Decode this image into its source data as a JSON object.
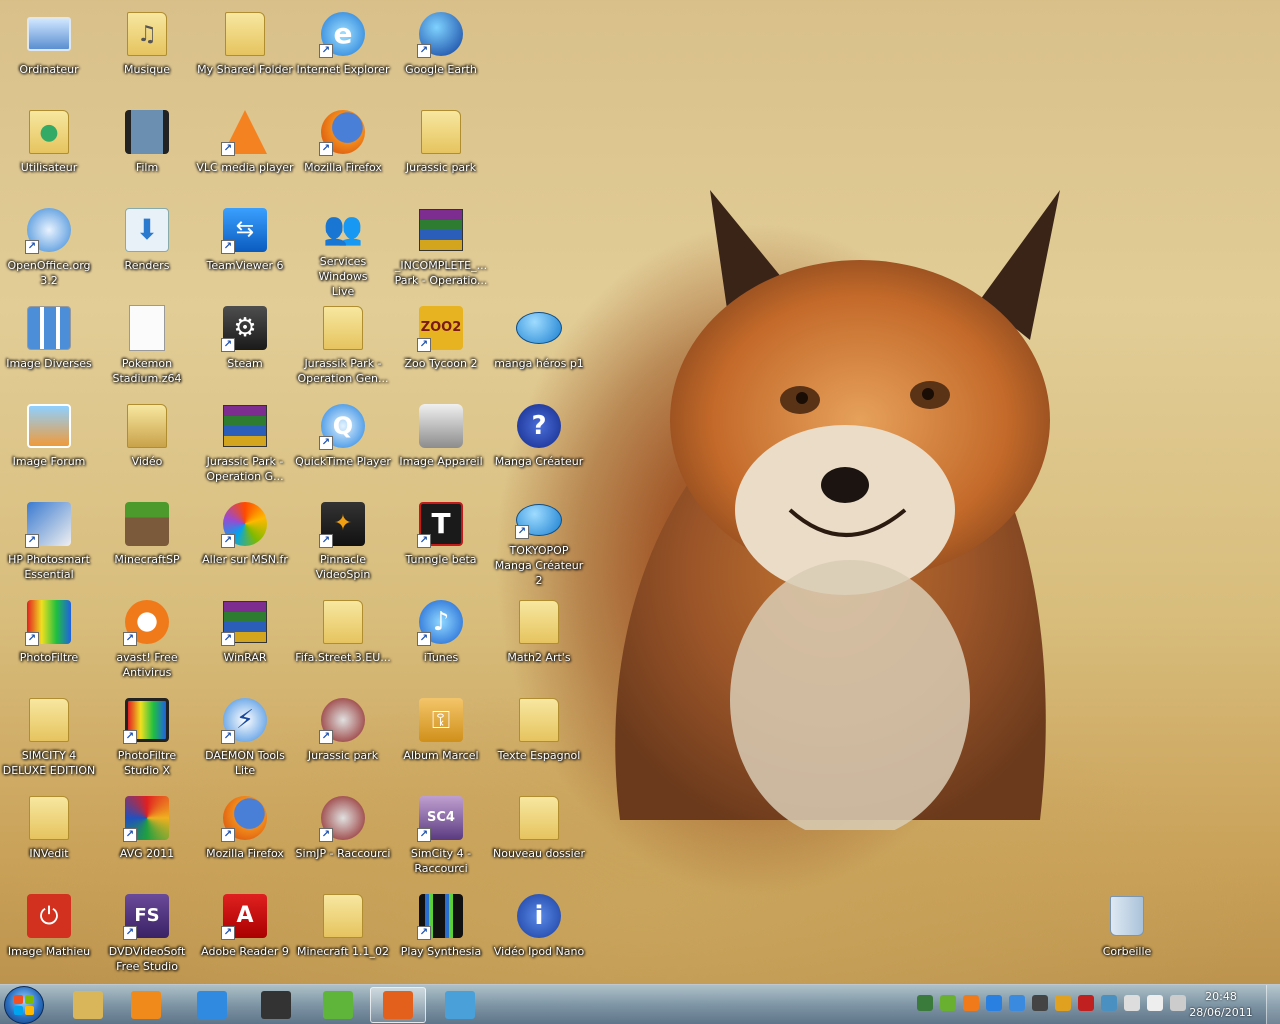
{
  "desktop": {
    "icons": [
      {
        "label": "Ordinateur",
        "icon": "computer-icon",
        "shortcut": false
      },
      {
        "label": "Musique",
        "icon": "music-folder-icon",
        "shortcut": false
      },
      {
        "label": "My Shared Folder",
        "icon": "folder-icon",
        "shortcut": false
      },
      {
        "label": "Internet Explorer",
        "icon": "internet-explorer-icon",
        "shortcut": true
      },
      {
        "label": "Google Earth",
        "icon": "google-earth-icon",
        "shortcut": true
      },
      {
        "label": "Utilisateur",
        "icon": "user-folder-icon",
        "shortcut": false
      },
      {
        "label": "Film",
        "icon": "film-icon",
        "shortcut": false
      },
      {
        "label": "VLC media player",
        "icon": "vlc-icon",
        "shortcut": true
      },
      {
        "label": "Mozilla Firefox",
        "icon": "firefox-icon",
        "shortcut": true
      },
      {
        "label": "Jurassic park",
        "icon": "folder-icon",
        "shortcut": false
      },
      {
        "label": "OpenOffice.org\n3.2",
        "icon": "openoffice-icon",
        "shortcut": true
      },
      {
        "label": "Renders",
        "icon": "download-folder-icon",
        "shortcut": false
      },
      {
        "label": "TeamViewer 6",
        "icon": "teamviewer-icon",
        "shortcut": true
      },
      {
        "label": "Services Windows\nLive",
        "icon": "windows-live-icon",
        "shortcut": false
      },
      {
        "label": "_INCOMPLETE_...\nPark - Operatio...",
        "icon": "winrar-archive-icon",
        "shortcut": false
      },
      {
        "label": "Image Diverses",
        "icon": "image-grid-icon",
        "shortcut": false
      },
      {
        "label": "Pokemon\nStadium.z64",
        "icon": "file-icon",
        "shortcut": false
      },
      {
        "label": "Steam",
        "icon": "steam-icon",
        "shortcut": true
      },
      {
        "label": "Jurassik Park -\nOperation Gen...",
        "icon": "folder-icon",
        "shortcut": false
      },
      {
        "label": "Zoo Tycoon 2",
        "icon": "zoo-tycoon-icon",
        "shortcut": true
      },
      {
        "label": "manga héros p1",
        "icon": "speech-bubble-icon",
        "shortcut": false
      },
      {
        "label": "Image Forum",
        "icon": "picture-icon",
        "shortcut": false
      },
      {
        "label": "Vidéo",
        "icon": "video-folder-icon",
        "shortcut": false
      },
      {
        "label": "Jurassic Park -\nOperation G...",
        "icon": "winrar-archive-icon",
        "shortcut": false
      },
      {
        "label": "QuickTime Player",
        "icon": "quicktime-icon",
        "shortcut": true
      },
      {
        "label": "Image Appareil",
        "icon": "camera-icon",
        "shortcut": false
      },
      {
        "label": "Manga Créateur",
        "icon": "help-icon",
        "shortcut": false
      },
      {
        "label": "HP Photosmart\nEssential",
        "icon": "hp-photosmart-icon",
        "shortcut": true
      },
      {
        "label": "MinecraftSP",
        "icon": "minecraft-icon",
        "shortcut": false
      },
      {
        "label": "Aller sur MSN.fr",
        "icon": "msn-icon",
        "shortcut": true
      },
      {
        "label": "Pinnacle\nVideoSpin",
        "icon": "videospin-icon",
        "shortcut": true
      },
      {
        "label": "Tunngle beta",
        "icon": "tunngle-icon",
        "shortcut": true
      },
      {
        "label": "TOKYOPOP\nManga Créateur 2",
        "icon": "speech-bubble-icon",
        "shortcut": true
      },
      {
        "label": "PhotoFiltre",
        "icon": "photofiltre-icon",
        "shortcut": true
      },
      {
        "label": "avast! Free\nAntivirus",
        "icon": "avast-icon",
        "shortcut": true
      },
      {
        "label": "WinRAR",
        "icon": "winrar-icon",
        "shortcut": true
      },
      {
        "label": "Fifa.Street.3.EU...",
        "icon": "folder-icon",
        "shortcut": false
      },
      {
        "label": "iTunes",
        "icon": "itunes-icon",
        "shortcut": true
      },
      {
        "label": "Math2 Art's",
        "icon": "folder-icon",
        "shortcut": false
      },
      {
        "label": "SIMCITY 4\nDELUXE EDITION",
        "icon": "folder-icon",
        "shortcut": false
      },
      {
        "label": "PhotoFiltre\nStudio X",
        "icon": "photofiltre-studio-icon",
        "shortcut": true
      },
      {
        "label": "DAEMON Tools\nLite",
        "icon": "daemon-tools-icon",
        "shortcut": true
      },
      {
        "label": "Jurassic park",
        "icon": "jurassic-park-icon",
        "shortcut": true
      },
      {
        "label": "Album Marcel",
        "icon": "key-icon",
        "shortcut": false
      },
      {
        "label": "Texte Espagnol",
        "icon": "folder-icon",
        "shortcut": false
      },
      {
        "label": "INVedit",
        "icon": "folder-icon",
        "shortcut": false
      },
      {
        "label": "AVG 2011",
        "icon": "avg-icon",
        "shortcut": true
      },
      {
        "label": "Mozilla Firefox",
        "icon": "firefox-icon",
        "shortcut": true
      },
      {
        "label": "SimJP - Raccourci",
        "icon": "jurassic-park-icon",
        "shortcut": true
      },
      {
        "label": "SimCity 4 -\nRaccourci",
        "icon": "simcity4-icon",
        "shortcut": true
      },
      {
        "label": "Nouveau dossier",
        "icon": "folder-icon",
        "shortcut": false
      },
      {
        "label": "Image Mathieu",
        "icon": "power-icon",
        "shortcut": false
      },
      {
        "label": "DVDVideoSoft\nFree Studio",
        "icon": "dvdvideosoft-icon",
        "shortcut": true
      },
      {
        "label": "Adobe Reader 9",
        "icon": "adobe-reader-icon",
        "shortcut": true
      },
      {
        "label": "Minecraft 1.1_02",
        "icon": "folder-icon",
        "shortcut": false
      },
      {
        "label": "Play Synthesia",
        "icon": "synthesia-icon",
        "shortcut": true
      },
      {
        "label": "Vidéo Ipod Nano",
        "icon": "info-icon",
        "shortcut": false
      },
      {
        "label": "Corbeille",
        "icon": "recycle-bin-icon",
        "shortcut": false
      }
    ]
  },
  "taskbar": {
    "pinned": [
      {
        "name": "explorer-icon",
        "color": "#d9b65a"
      },
      {
        "name": "media-player-icon",
        "color": "#f08a1a"
      },
      {
        "name": "internet-explorer-icon",
        "color": "#2f8ae0"
      },
      {
        "name": "photofiltre-studio-icon",
        "color": "#333333"
      },
      {
        "name": "photofiltre-icon",
        "color": "#5fb53a"
      },
      {
        "name": "firefox-icon",
        "color": "#e2601c",
        "active": true
      },
      {
        "name": "windows-live-icon",
        "color": "#4aa0d8"
      }
    ],
    "tray": [
      "network-icon",
      "utorrent-icon",
      "avast-icon",
      "teamviewer-icon",
      "daemon-icon",
      "steam-icon",
      "avg-icon",
      "adobe-icon",
      "update-icon",
      "volume-icon",
      "flag-icon",
      "signal-icon"
    ],
    "time": "20:48",
    "date": "28/06/2011"
  },
  "colors": {
    "label_text": "#ffffff",
    "taskbar": "#7c99b3"
  }
}
